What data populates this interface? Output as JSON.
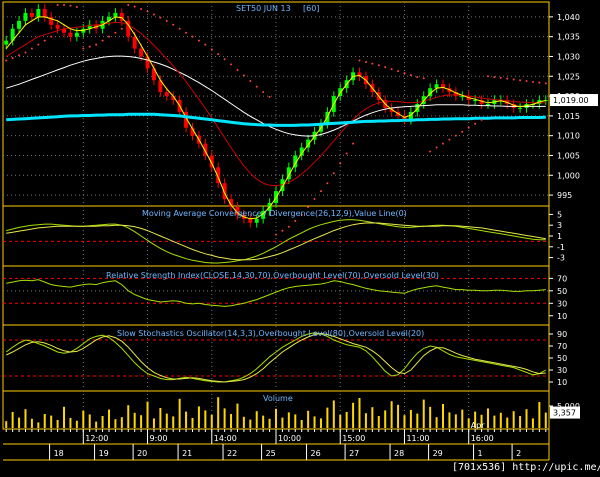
{
  "title": "SET50 JUN 13",
  "interval": "[60]",
  "watermark": "[701x536] http://upic.me/",
  "colors": {
    "up": "#00ff00",
    "down": "#ff0000",
    "ma_slow": "#00e5ff",
    "ma_mid": "#ffffff",
    "ma_red": "#cc0000",
    "ma_fast": "#ffff00",
    "grid": "#777777",
    "panel_border": "#ffcc00",
    "psar": "#ff4040",
    "vol": "#ffd700",
    "tagbg": "#ffffff"
  },
  "panels": {
    "price": {
      "title": "SET50 JUN 13  [60]",
      "last_label": "1,019.00",
      "ticks": [
        "1,040",
        "1,035",
        "1,030",
        "1,025",
        "1,020",
        "1,015",
        "1,010",
        "1,005",
        "1,000",
        "995"
      ],
      "ylim": [
        993,
        1043
      ]
    },
    "macd": {
      "title": "Moving Average Convergence / Divergence(26,12,9),Value Line(0)",
      "ticks": [
        "5",
        "3",
        "1",
        "-1",
        "-3"
      ],
      "ylim": [
        -4,
        6
      ]
    },
    "rsi": {
      "title": "Relative Strength Index(CLOSE,14,30,70),Overbought Level(70),Oversold Level(30)",
      "ticks": [
        "70",
        "50",
        "30",
        "10"
      ],
      "ylim": [
        0,
        85
      ]
    },
    "stoch": {
      "title": "Slow Stochastics Oscillator(14,3,3),Overbought Level(80),Oversold Level(20)",
      "ticks": [
        "90",
        "70",
        "50",
        "30",
        "10"
      ],
      "ylim": [
        0,
        100
      ]
    },
    "volume": {
      "title": "Volume",
      "ticks": [
        "5,000"
      ],
      "last_label": "3,357",
      "ylim": [
        0,
        8000
      ]
    }
  },
  "x_axis": {
    "times": [
      {
        "label": "12:00",
        "bar": 12
      },
      {
        "label": "9:00",
        "bar": 22
      },
      {
        "label": "14:00",
        "bar": 32
      },
      {
        "label": "10:00",
        "bar": 42
      },
      {
        "label": "15:00",
        "bar": 52
      },
      {
        "label": "11:00",
        "bar": 62
      },
      {
        "label": "16:00",
        "bar": 72
      }
    ],
    "month_label": {
      "label": "Apr",
      "bar": 72
    },
    "dates": [
      {
        "label": "18",
        "bar": 8
      },
      {
        "label": "19",
        "bar": 15
      },
      {
        "label": "20",
        "bar": 21
      },
      {
        "label": "21",
        "bar": 28
      },
      {
        "label": "22",
        "bar": 35
      },
      {
        "label": "25",
        "bar": 41
      },
      {
        "label": "26",
        "bar": 48
      },
      {
        "label": "27",
        "bar": 54
      },
      {
        "label": "28",
        "bar": 61
      },
      {
        "label": "29",
        "bar": 67
      },
      {
        "label": "1",
        "bar": 74
      },
      {
        "label": "2",
        "bar": 80
      }
    ]
  },
  "chart_data": {
    "type": "line",
    "price": {
      "bars": 85,
      "close": [
        1034,
        1037,
        1039,
        1041,
        1040,
        1042,
        1040,
        1038,
        1037,
        1036,
        1035,
        1036,
        1037,
        1038,
        1037,
        1039,
        1040,
        1041,
        1039,
        1035,
        1032,
        1030,
        1027,
        1024,
        1021,
        1020,
        1019,
        1016,
        1012,
        1010,
        1008,
        1005,
        1002,
        998,
        994,
        992,
        990,
        989,
        988,
        989,
        991,
        993,
        996,
        999,
        1002,
        1005,
        1007,
        1009,
        1011,
        1013,
        1016,
        1020,
        1022,
        1024,
        1026,
        1025,
        1023,
        1021,
        1019,
        1017,
        1016,
        1015,
        1014,
        1016,
        1018,
        1020,
        1022,
        1023,
        1022,
        1021,
        1020,
        1020,
        1019,
        1019,
        1018,
        1018,
        1019,
        1019,
        1018,
        1017,
        1017,
        1018,
        1018,
        1019,
        1019
      ],
      "ma_slow": [
        1014,
        1014.1,
        1014.2,
        1014.3,
        1014.4,
        1014.5,
        1014.6,
        1014.7,
        1014.8,
        1014.9,
        1015,
        1015,
        1015.1,
        1015.1,
        1015.2,
        1015.2,
        1015.3,
        1015.3,
        1015.3,
        1015.4,
        1015.4,
        1015.4,
        1015.4,
        1015.4,
        1015.3,
        1015.2,
        1015.1,
        1015,
        1014.8,
        1014.6,
        1014.4,
        1014.2,
        1014,
        1013.8,
        1013.6,
        1013.4,
        1013.2,
        1013,
        1012.9,
        1012.8,
        1012.7,
        1012.7,
        1012.6,
        1012.6,
        1012.6,
        1012.6,
        1012.7,
        1012.7,
        1012.8,
        1012.9,
        1013,
        1013.1,
        1013.2,
        1013.3,
        1013.4,
        1013.5,
        1013.6,
        1013.6,
        1013.7,
        1013.7,
        1013.8,
        1013.8,
        1013.9,
        1013.9,
        1014,
        1014,
        1014.1,
        1014.1,
        1014.2,
        1014.2,
        1014.3,
        1014.3,
        1014.3,
        1014.4,
        1014.4,
        1014.4,
        1014.5,
        1014.5,
        1014.5,
        1014.5,
        1014.6,
        1014.6,
        1014.6,
        1014.6,
        1014.7
      ],
      "ma_mid": [
        1022,
        1022.5,
        1023,
        1023.6,
        1024.2,
        1024.8,
        1025.4,
        1026,
        1026.6,
        1027.2,
        1027.8,
        1028.3,
        1028.8,
        1029.2,
        1029.5,
        1029.8,
        1030,
        1030.1,
        1030.1,
        1030,
        1029.8,
        1029.5,
        1029.1,
        1028.6,
        1028.1,
        1027.5,
        1026.8,
        1026,
        1025.2,
        1024.3,
        1023.4,
        1022.4,
        1021.4,
        1020.3,
        1019.2,
        1018.1,
        1017,
        1015.9,
        1014.9,
        1014,
        1013.1,
        1012.3,
        1011.6,
        1011,
        1010.5,
        1010.2,
        1010,
        1009.9,
        1010,
        1010.3,
        1010.8,
        1011.4,
        1012.1,
        1012.9,
        1013.7,
        1014.5,
        1015.2,
        1015.8,
        1016.3,
        1016.7,
        1017,
        1017.2,
        1017.3,
        1017.4,
        1017.5,
        1017.6,
        1017.7,
        1017.8,
        1017.8,
        1017.8,
        1017.8,
        1017.8,
        1017.7,
        1017.7,
        1017.6,
        1017.6,
        1017.5,
        1017.5,
        1017.4,
        1017.4,
        1017.4,
        1017.4,
        1017.4,
        1017.4,
        1017.4
      ],
      "ma_red": [
        1030,
        1031,
        1032,
        1033,
        1034,
        1035,
        1035.5,
        1036,
        1036.5,
        1037,
        1037.2,
        1037.4,
        1037.6,
        1037.8,
        1038,
        1038.2,
        1038.4,
        1038.6,
        1038.5,
        1038,
        1037,
        1035.8,
        1034.4,
        1032.8,
        1031.1,
        1029.4,
        1027.6,
        1025.7,
        1023.6,
        1021.4,
        1019.2,
        1016.9,
        1014.5,
        1012,
        1009.5,
        1007,
        1004.6,
        1002.4,
        1000.5,
        999,
        998,
        997.5,
        997.4,
        997.6,
        998.2,
        999.1,
        1000.3,
        1001.7,
        1003.3,
        1005,
        1006.8,
        1008.7,
        1010.6,
        1012.4,
        1014.1,
        1015.6,
        1016.8,
        1017.7,
        1018.3,
        1018.6,
        1018.7,
        1018.6,
        1018.4,
        1018.3,
        1018.4,
        1018.7,
        1019.2,
        1019.7,
        1020.1,
        1020.3,
        1020.3,
        1020.2,
        1020,
        1019.8,
        1019.5,
        1019.3,
        1019.1,
        1019,
        1018.8,
        1018.6,
        1018.5,
        1018.4,
        1018.3,
        1018.3,
        1018.3
      ],
      "ma_fast": [
        1032,
        1034,
        1036,
        1038,
        1039,
        1040,
        1040,
        1039.5,
        1039,
        1038,
        1037,
        1036.5,
        1036.6,
        1037,
        1037.5,
        1038,
        1039,
        1040,
        1039.8,
        1038,
        1035.5,
        1032.8,
        1030,
        1027,
        1024,
        1021.8,
        1020,
        1017.6,
        1014.5,
        1011.7,
        1009,
        1006.1,
        1003,
        999.5,
        995.5,
        992.5,
        990.5,
        989.5,
        989,
        989.2,
        990.3,
        992,
        994.3,
        997.1,
        1000,
        1003,
        1005.5,
        1007.7,
        1009.8,
        1012,
        1014.8,
        1018,
        1020.8,
        1023,
        1025,
        1025.2,
        1024,
        1022,
        1020,
        1018,
        1016.6,
        1015.6,
        1014.6,
        1015.2,
        1016.8,
        1018.8,
        1020.7,
        1022,
        1022.2,
        1021.6,
        1020.8,
        1020.2,
        1019.6,
        1019.2,
        1018.7,
        1018.3,
        1018.5,
        1018.8,
        1018.4,
        1017.7,
        1017.3,
        1017.6,
        1017.9,
        1018.5,
        1018.9
      ],
      "psar": [
        1029,
        1029.6,
        1030.3,
        1031,
        1032,
        1033,
        1034,
        1035,
        1043,
        1043,
        1042.8,
        1042.5,
        1032,
        1032.5,
        1033,
        1034,
        1035,
        1036,
        1037,
        1043,
        1042.6,
        1042,
        1041.4,
        1040.6,
        1039.8,
        1039,
        1038,
        1037,
        1036,
        1035,
        1034,
        1033,
        1031.8,
        1030.6,
        1029.3,
        1028,
        1026.6,
        1025.2,
        1023.8,
        1022.4,
        1021,
        1019.8,
        985,
        986,
        987,
        988.5,
        990,
        992,
        994,
        996,
        998,
        1000.5,
        1003,
        1005.5,
        1008,
        1029,
        1028.6,
        1028.2,
        1027.8,
        1027.3,
        1026.8,
        1026.3,
        1025.8,
        1025.3,
        1024.8,
        1024.5,
        1006,
        1007,
        1008,
        1009,
        1010,
        1011,
        1012,
        1013,
        1014,
        1025,
        1024.8,
        1024.6,
        1024.4,
        1024.2,
        1024,
        1023.8,
        1023.6,
        1023.4,
        1023.2
      ]
    },
    "macd": {
      "line": [
        2,
        2.3,
        2.6,
        2.8,
        3,
        3.1,
        3.2,
        3.2,
        3.1,
        3,
        2.9,
        2.8,
        2.8,
        2.9,
        3,
        3.1,
        3.2,
        3.2,
        3,
        2.5,
        1.8,
        1,
        0.2,
        -0.6,
        -1.3,
        -1.9,
        -2.4,
        -2.8,
        -3.2,
        -3.5,
        -3.7,
        -3.9,
        -4,
        -4,
        -3.9,
        -3.8,
        -3.6,
        -3.4,
        -3.1,
        -2.7,
        -2.2,
        -1.6,
        -1,
        -0.3,
        0.4,
        1,
        1.6,
        2.2,
        2.7,
        3.1,
        3.4,
        3.7,
        3.9,
        4,
        4,
        3.9,
        3.7,
        3.5,
        3.3,
        3.1,
        2.9,
        2.7,
        2.6,
        2.6,
        2.7,
        2.8,
        2.9,
        3,
        3,
        2.9,
        2.8,
        2.6,
        2.4,
        2.2,
        2,
        1.8,
        1.6,
        1.4,
        1.2,
        1,
        0.8,
        0.6,
        0.4,
        0.3,
        0.3
      ],
      "signal": [
        1.5,
        1.7,
        1.9,
        2.1,
        2.3,
        2.5,
        2.6,
        2.7,
        2.8,
        2.8,
        2.8,
        2.8,
        2.8,
        2.8,
        2.8,
        2.9,
        2.9,
        3,
        3,
        2.9,
        2.7,
        2.4,
        2,
        1.5,
        1,
        0.5,
        0,
        -0.5,
        -1,
        -1.5,
        -1.9,
        -2.3,
        -2.6,
        -2.9,
        -3.1,
        -3.3,
        -3.4,
        -3.4,
        -3.4,
        -3.3,
        -3.1,
        -2.8,
        -2.5,
        -2.1,
        -1.6,
        -1.1,
        -0.6,
        0,
        0.5,
        1,
        1.5,
        2,
        2.4,
        2.8,
        3.1,
        3.3,
        3.4,
        3.4,
        3.4,
        3.3,
        3.2,
        3.1,
        3,
        2.9,
        2.8,
        2.8,
        2.8,
        2.8,
        2.9,
        2.9,
        2.9,
        2.8,
        2.7,
        2.6,
        2.5,
        2.3,
        2.1,
        1.9,
        1.7,
        1.5,
        1.3,
        1.1,
        0.9,
        0.7,
        0.5
      ]
    },
    "rsi": [
      62,
      64,
      66,
      67,
      66,
      68,
      64,
      60,
      58,
      57,
      56,
      58,
      60,
      61,
      60,
      63,
      65,
      66,
      60,
      50,
      44,
      40,
      36,
      34,
      32,
      33,
      34,
      33,
      30,
      29,
      30,
      28,
      27,
      26,
      25,
      26,
      28,
      30,
      33,
      36,
      40,
      44,
      48,
      52,
      55,
      57,
      58,
      59,
      60,
      61,
      63,
      66,
      65,
      62,
      60,
      57,
      54,
      52,
      50,
      49,
      48,
      47,
      46,
      50,
      53,
      55,
      57,
      58,
      56,
      54,
      52,
      52,
      51,
      51,
      50,
      50,
      51,
      51,
      50,
      49,
      49,
      50,
      50,
      51,
      52
    ],
    "stoch": {
      "k": [
        60,
        68,
        75,
        80,
        78,
        74,
        70,
        65,
        60,
        58,
        60,
        66,
        74,
        82,
        86,
        88,
        84,
        76,
        66,
        54,
        42,
        32,
        24,
        20,
        16,
        14,
        14,
        16,
        18,
        16,
        14,
        12,
        11,
        10,
        10,
        12,
        14,
        18,
        24,
        32,
        42,
        52,
        60,
        68,
        74,
        80,
        86,
        90,
        92,
        90,
        86,
        80,
        76,
        72,
        70,
        68,
        62,
        52,
        40,
        28,
        20,
        22,
        32,
        46,
        58,
        66,
        70,
        68,
        62,
        56,
        52,
        50,
        48,
        46,
        44,
        42,
        40,
        38,
        36,
        34,
        30,
        26,
        22,
        24,
        30
      ],
      "d": [
        55,
        60,
        66,
        72,
        76,
        77,
        75,
        71,
        66,
        62,
        60,
        61,
        66,
        73,
        80,
        85,
        87,
        84,
        78,
        68,
        56,
        44,
        34,
        26,
        21,
        17,
        15,
        15,
        16,
        17,
        16,
        14,
        12,
        11,
        10,
        11,
        12,
        14,
        18,
        24,
        32,
        42,
        51,
        60,
        67,
        74,
        80,
        85,
        89,
        91,
        89,
        86,
        82,
        78,
        74,
        71,
        68,
        62,
        54,
        44,
        34,
        26,
        24,
        30,
        42,
        54,
        62,
        67,
        67,
        63,
        58,
        54,
        51,
        48,
        46,
        44,
        42,
        40,
        38,
        36,
        34,
        31,
        27,
        24,
        25
      ]
    },
    "volume": [
      1200,
      3500,
      2100,
      4200,
      1800,
      900,
      3000,
      2600,
      1500,
      4800,
      2000,
      1300,
      3800,
      2900,
      1100,
      2500,
      4100,
      1700,
      2200,
      5200,
      3300,
      2700,
      6100,
      1900,
      4500,
      3100,
      2400,
      6800,
      3600,
      2000,
      4900,
      3900,
      2800,
      7200,
      4400,
      3000,
      5600,
      2300,
      1600,
      3700,
      2600,
      1800,
      4300,
      2100,
      3400,
      2900,
      1500,
      3800,
      2400,
      1900,
      4600,
      6400,
      2800,
      3500,
      5800,
      7000,
      3200,
      4700,
      2500,
      3900,
      6200,
      5300,
      2700,
      4000,
      3100,
      6600,
      4800,
      2200,
      5500,
      3400,
      2900,
      4100,
      1900,
      3600,
      2800,
      4400,
      2600,
      3300,
      2100,
      3700,
      2500,
      4200,
      1900,
      6000,
      3357
    ]
  }
}
